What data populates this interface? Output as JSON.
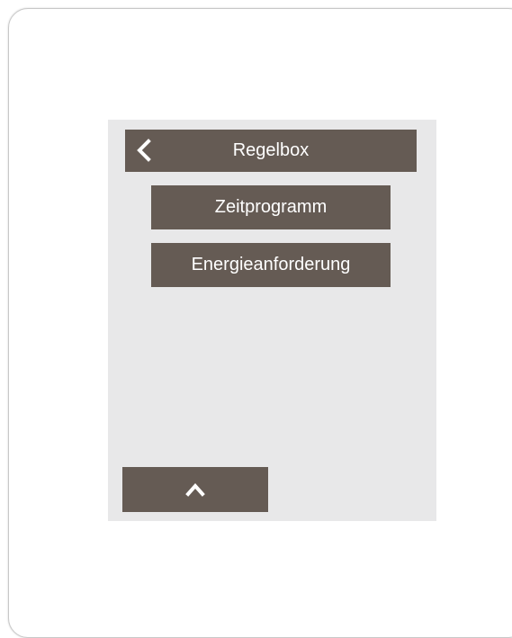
{
  "colors": {
    "panel": "#e8e8e9",
    "button": "#655b54",
    "button_text": "#ffffff"
  },
  "header": {
    "title": "Regelbox",
    "back_icon": "chevron-left-icon"
  },
  "menu": {
    "items": [
      {
        "label": "Zeitprogramm"
      },
      {
        "label": "Energieanforderung"
      }
    ]
  },
  "footer": {
    "up_icon": "chevron-up-icon"
  }
}
